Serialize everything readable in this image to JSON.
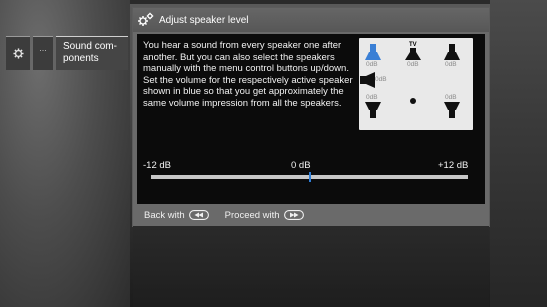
{
  "nav": {
    "dots_label": "...",
    "sound_components_label": "Sound com-\nponents"
  },
  "dialog": {
    "title": "Adjust speaker level",
    "description": "You hear a sound from every speaker one after another. But you can also select the speakers manually with the menu control buttons up/down. Set the volume for the respectively active speaker shown in blue so that you get approximately the same volume impression from all the speakers."
  },
  "speakers": {
    "tv_label": "TV",
    "front_left_db": "0dB",
    "center_db": "0dB",
    "front_right_db": "0dB",
    "side_left_db": "0dB",
    "rear_left_db": "0dB",
    "rear_right_db": "0dB",
    "active_speaker": "front-left",
    "active_color": "#3a7fd5"
  },
  "slider": {
    "min_label": "-12 dB",
    "mid_label": "0 dB",
    "max_label": "+12 dB",
    "value_db": 0
  },
  "footer": {
    "back_label": "Back with",
    "proceed_label": "Proceed with"
  },
  "icons": {
    "title_icon": "speaker-settings-icon",
    "nav_icon": "gear-icon"
  }
}
